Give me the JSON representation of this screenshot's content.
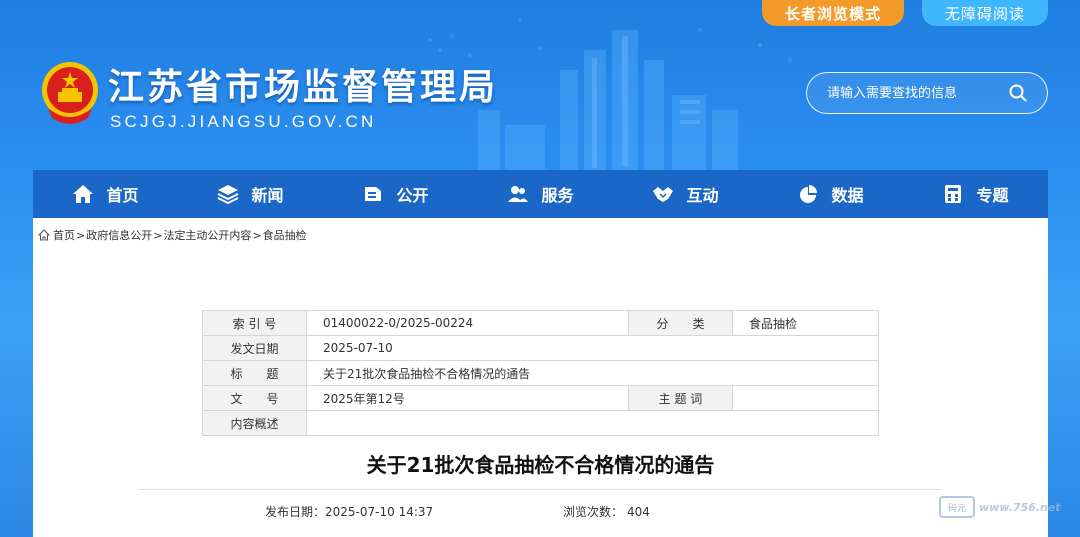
{
  "top_buttons": {
    "elder_mode": "长者浏览模式",
    "accessible": "无障碍阅读"
  },
  "site": {
    "title": "江苏省市场监督管理局",
    "domain": "SCJGJ.JIANGSU.GOV.CN"
  },
  "search": {
    "placeholder": "请输入需要查找的信息"
  },
  "nav": {
    "items": [
      {
        "label": "首页",
        "icon": "home-icon"
      },
      {
        "label": "新闻",
        "icon": "layers-icon"
      },
      {
        "label": "公开",
        "icon": "box-icon"
      },
      {
        "label": "服务",
        "icon": "users-icon"
      },
      {
        "label": "互动",
        "icon": "handshake-icon"
      },
      {
        "label": "数据",
        "icon": "pie-chart-icon"
      },
      {
        "label": "专题",
        "icon": "calculator-icon"
      }
    ]
  },
  "breadcrumb": {
    "items": [
      "首页",
      "政府信息公开",
      "法定主动公开内容",
      "食品抽检"
    ],
    "separator": ">"
  },
  "meta": {
    "index_label": "索 引 号",
    "index_value": "01400022-0/2025-00224",
    "category_label": "分　　类",
    "category_value": "食品抽检",
    "date_label": "发文日期",
    "date_value": "2025-07-10",
    "title_label": "标　　题",
    "title_value": "关于21批次食品抽检不合格情况的通告",
    "doc_no_label": "文　　号",
    "doc_no_value": "2025年第12号",
    "keyword_label": "主 题 词",
    "keyword_value": "",
    "summary_label": "内容概述",
    "summary_value": ""
  },
  "article": {
    "title": "关于21批次食品抽检不合格情况的通告",
    "pub_label": "发布日期：",
    "pub_value": "2025-07-10 14:37",
    "views_label": "浏览次数：",
    "views_value": "404"
  },
  "watermark": {
    "logo": "码元",
    "text": "www.756.net"
  },
  "colors": {
    "header_blue": "#2a8ef0",
    "nav_blue": "#1a67c8",
    "elder_orange": "#f39a2b",
    "access_blue": "#3fb6ff"
  }
}
